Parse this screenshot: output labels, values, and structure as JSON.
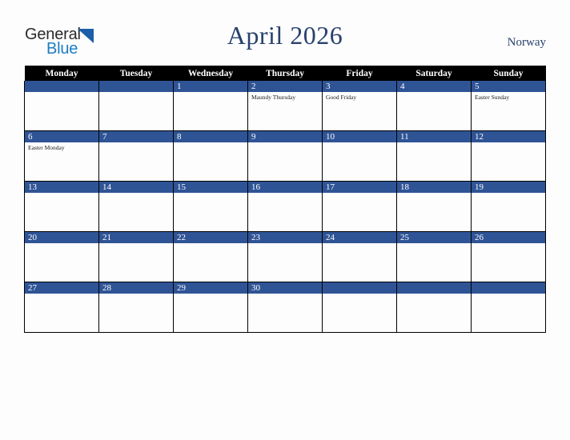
{
  "brand": {
    "word_one": "General",
    "word_two": "Blue",
    "triangle_icon": "triangle-icon",
    "color_dark": "#2b2b2b",
    "color_blue": "#1b7cc4",
    "color_triangle": "#1b5fa8"
  },
  "header": {
    "title": "April 2026",
    "country": "Norway",
    "title_color": "#28416d"
  },
  "calendar": {
    "weekday_headers": [
      "Monday",
      "Tuesday",
      "Wednesday",
      "Thursday",
      "Friday",
      "Saturday",
      "Sunday"
    ],
    "header_bg": "#000000",
    "daynum_bg": "#2f5496",
    "grid_border": "#000000",
    "weeks": [
      [
        {
          "day": "",
          "holiday": ""
        },
        {
          "day": "",
          "holiday": ""
        },
        {
          "day": "1",
          "holiday": ""
        },
        {
          "day": "2",
          "holiday": "Maundy Thursday"
        },
        {
          "day": "3",
          "holiday": "Good Friday"
        },
        {
          "day": "4",
          "holiday": ""
        },
        {
          "day": "5",
          "holiday": "Easter Sunday"
        }
      ],
      [
        {
          "day": "6",
          "holiday": "Easter Monday"
        },
        {
          "day": "7",
          "holiday": ""
        },
        {
          "day": "8",
          "holiday": ""
        },
        {
          "day": "9",
          "holiday": ""
        },
        {
          "day": "10",
          "holiday": ""
        },
        {
          "day": "11",
          "holiday": ""
        },
        {
          "day": "12",
          "holiday": ""
        }
      ],
      [
        {
          "day": "13",
          "holiday": ""
        },
        {
          "day": "14",
          "holiday": ""
        },
        {
          "day": "15",
          "holiday": ""
        },
        {
          "day": "16",
          "holiday": ""
        },
        {
          "day": "17",
          "holiday": ""
        },
        {
          "day": "18",
          "holiday": ""
        },
        {
          "day": "19",
          "holiday": ""
        }
      ],
      [
        {
          "day": "20",
          "holiday": ""
        },
        {
          "day": "21",
          "holiday": ""
        },
        {
          "day": "22",
          "holiday": ""
        },
        {
          "day": "23",
          "holiday": ""
        },
        {
          "day": "24",
          "holiday": ""
        },
        {
          "day": "25",
          "holiday": ""
        },
        {
          "day": "26",
          "holiday": ""
        }
      ],
      [
        {
          "day": "27",
          "holiday": ""
        },
        {
          "day": "28",
          "holiday": ""
        },
        {
          "day": "29",
          "holiday": ""
        },
        {
          "day": "30",
          "holiday": ""
        },
        {
          "day": "",
          "holiday": ""
        },
        {
          "day": "",
          "holiday": ""
        },
        {
          "day": "",
          "holiday": ""
        }
      ]
    ]
  }
}
